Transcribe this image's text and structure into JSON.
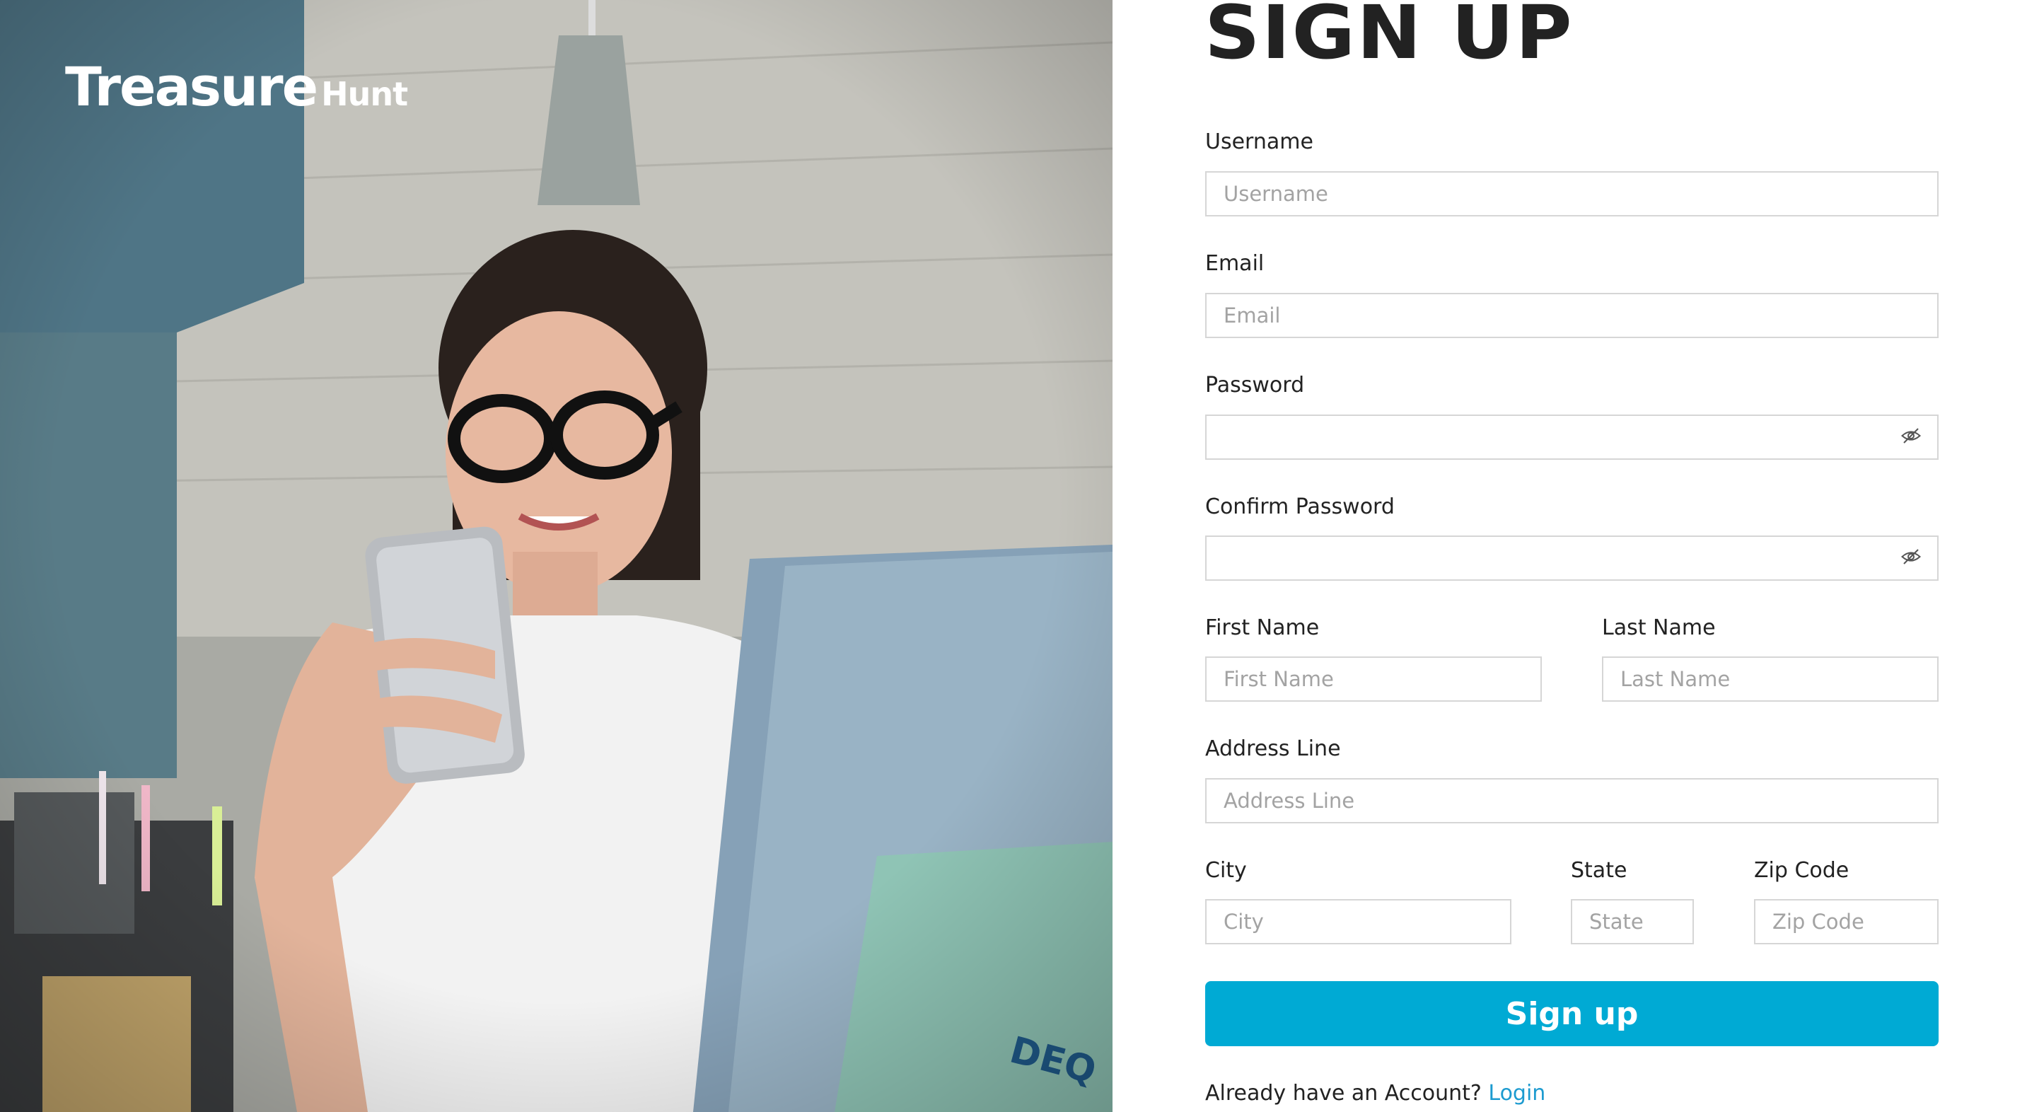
{
  "brand": {
    "name": "Treasure",
    "suffix": "Hunt"
  },
  "page": {
    "title": "SIGN UP"
  },
  "colors": {
    "accent": "#00aad4",
    "link": "#1d9bd0",
    "border": "#d6d6d6"
  },
  "form": {
    "username": {
      "label": "Username",
      "placeholder": "Username"
    },
    "email": {
      "label": "Email",
      "placeholder": "Email"
    },
    "password": {
      "label": "Password",
      "placeholder": "",
      "icon": "eye-slash-icon"
    },
    "confirm_password": {
      "label": "Confirm Password",
      "placeholder": "",
      "icon": "eye-slash-icon"
    },
    "first_name": {
      "label": "First Name",
      "placeholder": "First Name"
    },
    "last_name": {
      "label": "Last Name",
      "placeholder": "Last Name"
    },
    "address": {
      "label": "Address Line",
      "placeholder": "Address Line"
    },
    "city": {
      "label": "City",
      "placeholder": "City"
    },
    "state": {
      "label": "State",
      "placeholder": "State"
    },
    "zip": {
      "label": "Zip Code",
      "placeholder": "Zip Code"
    },
    "submit_label": "Sign up",
    "login_prompt": "Already have an Account?",
    "login_link": "Login"
  }
}
